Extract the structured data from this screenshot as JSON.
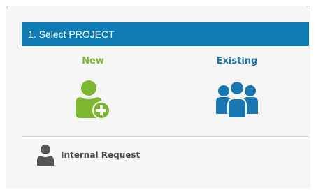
{
  "header": {
    "title": "1. Select PROJECT"
  },
  "options": {
    "new": {
      "label": "New",
      "icon": "add-user-icon",
      "color": "#7cb82f"
    },
    "existing": {
      "label": "Existing",
      "icon": "user-group-icon",
      "color": "#1a76b0"
    }
  },
  "internal_request": {
    "label": "Internal Request",
    "icon": "user-icon",
    "color": "#555555"
  },
  "colors": {
    "header_bg": "#0e7bb5",
    "panel_bg": "#f6f6f6"
  }
}
